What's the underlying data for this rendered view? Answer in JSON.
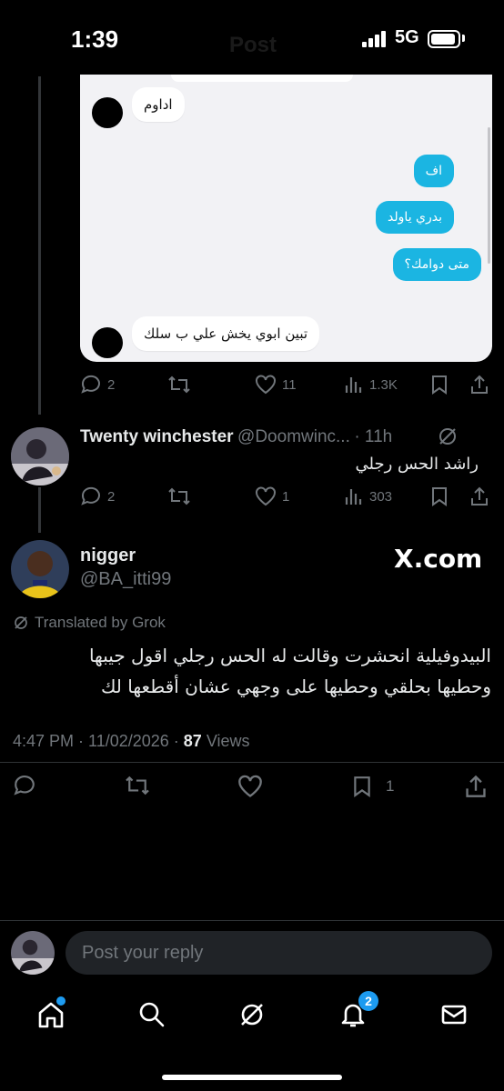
{
  "status_bar": {
    "time": "1:39",
    "network": "5G",
    "ghost_title": "Post"
  },
  "screenshot": {
    "messages": [
      {
        "side": "in",
        "text": "اداوم"
      },
      {
        "side": "out",
        "text": "اف"
      },
      {
        "side": "out",
        "text": "بدري ياولد"
      },
      {
        "side": "out",
        "text": "متى دوامك؟"
      },
      {
        "side": "in",
        "text": "تبين ابوي يخش علي ب سلك"
      }
    ]
  },
  "post_actions": {
    "replies": "2",
    "reposts": "",
    "likes": "11",
    "views": "1.3K"
  },
  "reply": {
    "name": "Twenty winchester",
    "handle": "@Doomwinc...",
    "time": "· 11h",
    "text": "راشد الحس رجلي",
    "replies": "2",
    "likes": "1",
    "views": "303"
  },
  "main_post": {
    "name": "nigger",
    "handle": "@BA_itti99",
    "watermark": "X.com",
    "translated_label": "Translated by Grok",
    "text_line1": "البيدوفيلية انحشرت وقالت له الحس رجلي اقول جيبها",
    "text_line2": "وحطيها بحلقي وحطيها على وجهي عشان أقطعها لك",
    "timestamp": "4:47 PM · 11/02/2026 ·",
    "views_count": "87",
    "views_label": "Views",
    "bookmarks": "1"
  },
  "reply_box": {
    "placeholder": "Post your reply"
  },
  "tabbar": {
    "notifications_badge": "2"
  },
  "colors": {
    "accent": "#1d9bf0",
    "bubble_out": "#1bb5e2",
    "chat_bg": "#f2f2f5",
    "muted": "#71767b"
  }
}
